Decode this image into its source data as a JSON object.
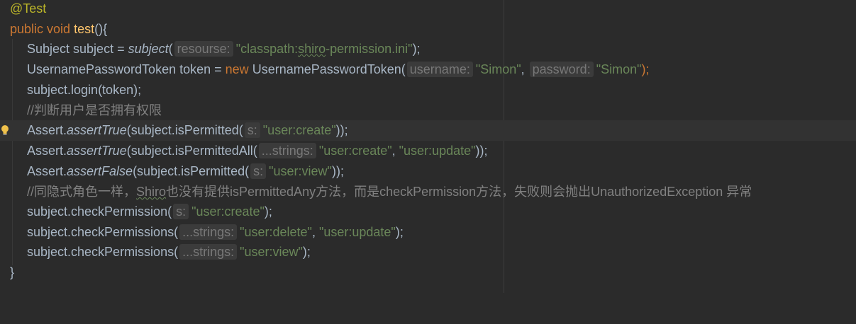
{
  "colors": {
    "background": "#2b2b2b",
    "current_line": "#323232",
    "keyword": "#cc7832",
    "annotation": "#bbb529",
    "method_decl": "#ffc66d",
    "string": "#6a8759",
    "comment": "#808080",
    "text": "#a9b7c6"
  },
  "code": {
    "annotation": "@Test",
    "decl": {
      "kw_public": "public",
      "kw_void": "void",
      "name": "test",
      "rest": "(){"
    },
    "l1": {
      "a": "Subject subject = ",
      "fn": "subject",
      "b": "(",
      "hint": "resourse:",
      "str_a": "\"classpath:",
      "str_squig": "shiro",
      "str_b": "-permission.ini\"",
      "end": ");"
    },
    "l2": {
      "a": "UsernamePasswordToken token = ",
      "kw_new": "new",
      "b": " UsernamePasswordToken(",
      "hint1": "username:",
      "str1": "\"Simon\"",
      "comma": ", ",
      "hint2": "password:",
      "str2": "\"Simon\"",
      "end": ");"
    },
    "l3": {
      "text": "subject.login(token);"
    },
    "l4": {
      "comment": "//判断用户是否拥有权限"
    },
    "l5": {
      "a": "Assert.",
      "fn": "assertTrue",
      "b": "(subject.isPermitted(",
      "hint": "s:",
      "str": "\"user:create\"",
      "end": "));"
    },
    "l6": {
      "a": "Assert.",
      "fn": "assertTrue",
      "b": "(subject.isPermittedAll(",
      "hint": "...strings:",
      "str1": "\"user:create\"",
      "comma": ", ",
      "str2": "\"user:update\"",
      "end": "));"
    },
    "l7": {
      "a": "Assert.",
      "fn": "assertFalse",
      "b": "(subject.isPermitted(",
      "hint": "s:",
      "str": "\"user:view\"",
      "end": "));"
    },
    "l8": {
      "c1": "//同隐式角色一样，",
      "c_squig": "Shiro",
      "c2": "也没有提供isPermittedAny方法，而是checkPermission方法，失败则会抛出UnauthorizedException 异常"
    },
    "l9": {
      "a": "subject.checkPermission(",
      "hint": "s:",
      "str": "\"user:create\"",
      "end": ");"
    },
    "l10": {
      "a": "subject.checkPermissions(",
      "hint": "...strings:",
      "str1": "\"user:delete\"",
      "comma": ", ",
      "str2": "\"user:update\"",
      "end": ");"
    },
    "l11": {
      "a": "subject.checkPermissions(",
      "hint": "...strings:",
      "str": "\"user:view\"",
      "end": ");"
    },
    "close": "}"
  },
  "icons": {
    "gutter": "lightbulb-icon"
  }
}
